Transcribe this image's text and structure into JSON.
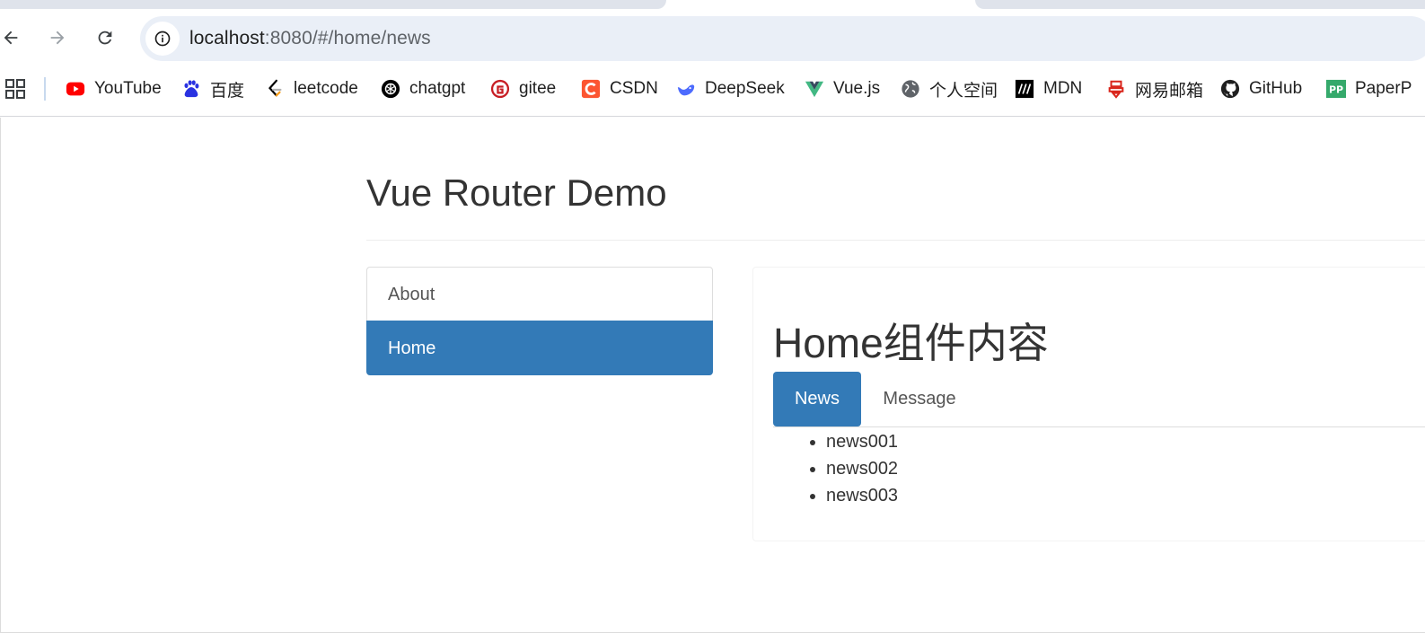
{
  "browser": {
    "url_host": "localhost",
    "url_rest": ":8080/#/home/news",
    "bookmarks": [
      {
        "label": "YouTube",
        "icon": "youtube-icon",
        "color": "#ff0000"
      },
      {
        "label": "百度",
        "icon": "baidu-icon",
        "color": "#2932e1"
      },
      {
        "label": "leetcode",
        "icon": "leetcode-icon",
        "color": "#f89f1b"
      },
      {
        "label": "chatgpt",
        "icon": "chatgpt-icon",
        "color": "#000000"
      },
      {
        "label": "gitee",
        "icon": "gitee-icon",
        "color": "#c71d23"
      },
      {
        "label": "CSDN",
        "icon": "csdn-icon",
        "color": "#fc5531"
      },
      {
        "label": "DeepSeek",
        "icon": "deepseek-icon",
        "color": "#4d6bfe"
      },
      {
        "label": "Vue.js",
        "icon": "vue-icon",
        "color": "#42b883"
      },
      {
        "label": "个人空间",
        "icon": "globe-icon",
        "color": "#5f6368"
      },
      {
        "label": "MDN",
        "icon": "mdn-icon",
        "color": "#000000"
      },
      {
        "label": "网易邮箱",
        "icon": "netease-mail-icon",
        "color": "#d9261c"
      },
      {
        "label": "GitHub",
        "icon": "github-icon",
        "color": "#1f1f1f"
      },
      {
        "label": "PaperP",
        "icon": "paperpass-icon",
        "color": "#35a96b"
      }
    ]
  },
  "page": {
    "title": "Vue Router Demo",
    "side_nav": [
      {
        "label": "About",
        "active": false
      },
      {
        "label": "Home",
        "active": true
      }
    ],
    "home_heading": "Home组件内容",
    "tabs": [
      {
        "label": "News",
        "active": true
      },
      {
        "label": "Message",
        "active": false
      }
    ],
    "news": [
      "news001",
      "news002",
      "news003"
    ],
    "accent_color": "#337ab7"
  }
}
